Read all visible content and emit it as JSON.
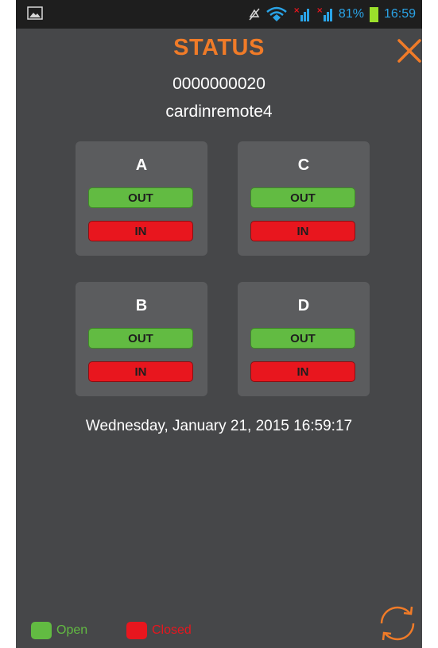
{
  "status_bar": {
    "battery": "81%",
    "time": "16:59",
    "icons": [
      "image-icon",
      "mute-icon",
      "wifi-icon",
      "signal-icon",
      "signal-icon",
      "battery-icon"
    ]
  },
  "header": {
    "title": "STATUS",
    "serial": "0000000020",
    "device_name": "cardinremote4"
  },
  "channels": [
    {
      "letter": "A",
      "out_label": "OUT",
      "in_label": "IN"
    },
    {
      "letter": "C",
      "out_label": "OUT",
      "in_label": "IN"
    },
    {
      "letter": "B",
      "out_label": "OUT",
      "in_label": "IN"
    },
    {
      "letter": "D",
      "out_label": "OUT",
      "in_label": "IN"
    }
  ],
  "datetime": "Wednesday, January 21, 2015 16:59:17",
  "legend": {
    "open_label": "Open",
    "closed_label": "Closed"
  },
  "colors": {
    "accent": "#f07b28",
    "open": "#62bb42",
    "closed": "#e8161e",
    "background": "#464749"
  }
}
